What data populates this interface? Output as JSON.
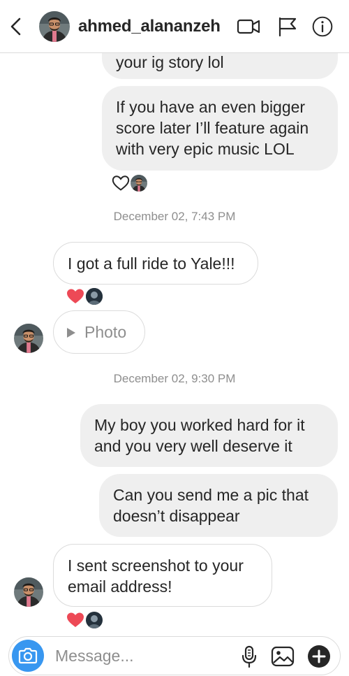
{
  "header": {
    "username": "ahmed_alananzeh",
    "icons": [
      "back-chevron-icon",
      "video-call-icon",
      "flag-icon",
      "info-icon"
    ]
  },
  "messages": [
    {
      "direction": "outgoing",
      "text": "your ig story lol",
      "partial": true
    },
    {
      "direction": "outgoing",
      "lines": [
        "If you have an even bigger",
        "score later I’ll feature again",
        "with very epic music LOL"
      ],
      "reaction": "heart-outline"
    },
    {
      "direction": "incoming",
      "text": "I got a full ride to Yale!!!",
      "reaction": "heart-filled"
    },
    {
      "direction": "incoming",
      "type": "photo",
      "label": "Photo"
    },
    {
      "direction": "outgoing",
      "lines": [
        "My boy you worked hard for it",
        "and you very well deserve it"
      ]
    },
    {
      "direction": "outgoing",
      "lines": [
        "Can you send me a pic that",
        "doesn’t disappear"
      ]
    },
    {
      "direction": "incoming",
      "lines": [
        "I sent screenshot to your",
        "email address!"
      ],
      "reaction": "heart-filled"
    }
  ],
  "timestamps": [
    "December 02, 7:43 PM",
    "December 02, 9:30 PM"
  ],
  "composer": {
    "placeholder": "Message...",
    "icons": [
      "camera-icon",
      "microphone-icon",
      "gallery-icon",
      "add-icon"
    ]
  },
  "colors": {
    "accent": "#3897f0",
    "heart": "#ed4956",
    "bubble_out": "#efefef",
    "border": "#dbdbdb",
    "muted": "#8e8e8e"
  }
}
